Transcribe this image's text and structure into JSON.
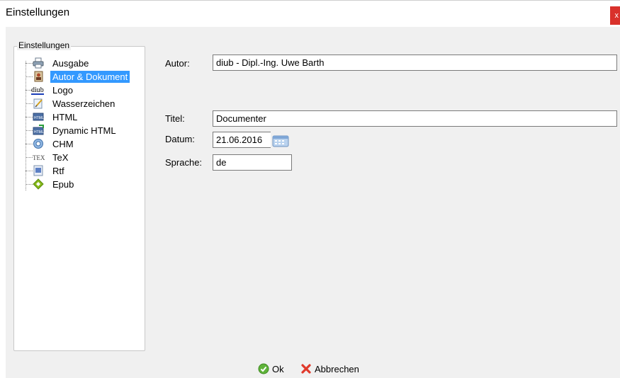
{
  "window": {
    "title": "Einstellungen",
    "close_glyph": "x"
  },
  "group_title": "Einstellungen",
  "tree": {
    "items": [
      {
        "label": "Ausgabe",
        "icon": "printer-icon"
      },
      {
        "label": "Autor & Dokument",
        "icon": "author-icon",
        "selected": true
      },
      {
        "label": "Logo",
        "icon": "diub-logo-icon",
        "icon_text": "diub"
      },
      {
        "label": "Wasserzeichen",
        "icon": "watermark-icon"
      },
      {
        "label": "HTML",
        "icon": "html-icon",
        "icon_text": "HTML"
      },
      {
        "label": "Dynamic HTML",
        "icon": "dynamic-html-icon",
        "icon_text": "HTML"
      },
      {
        "label": "CHM",
        "icon": "chm-icon"
      },
      {
        "label": "TeX",
        "icon": "tex-icon",
        "icon_text": "TEX"
      },
      {
        "label": "Rtf",
        "icon": "rtf-icon"
      },
      {
        "label": "Epub",
        "icon": "epub-icon"
      }
    ]
  },
  "form": {
    "autor_label": "Autor:",
    "autor_value": "diub - Dipl.-Ing. Uwe Barth",
    "titel_label": "Titel:",
    "titel_value": "Documenter",
    "datum_label": "Datum:",
    "datum_value": "21.06.2016",
    "sprache_label": "Sprache:",
    "sprache_value": "de"
  },
  "buttons": {
    "ok": "Ok",
    "cancel": "Abbrechen"
  },
  "colors": {
    "selection": "#3399ff",
    "close": "#d9312b",
    "dialog_bg": "#f0f0f0"
  }
}
